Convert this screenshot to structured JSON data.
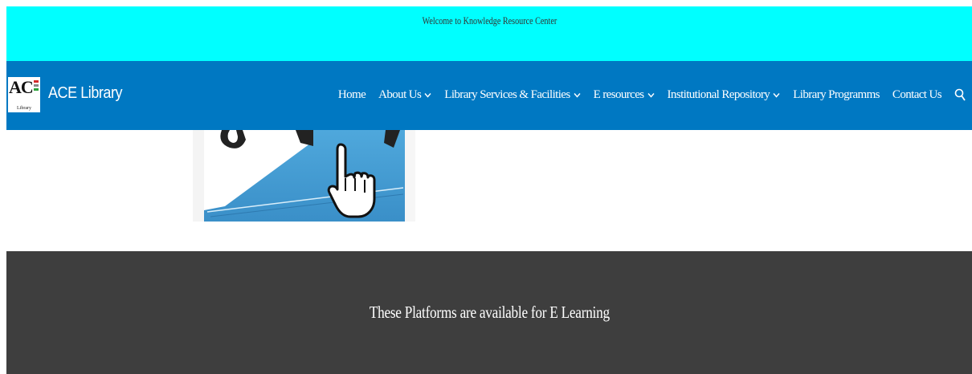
{
  "topbar": {
    "welcome_text": "Welcome to Knowledge Resource Center"
  },
  "header": {
    "logo_text": "AC",
    "logo_subtext": "Library",
    "brand": "ACE Library",
    "menu": [
      {
        "label": "Home",
        "has_dropdown": false
      },
      {
        "label": "About Us",
        "has_dropdown": true
      },
      {
        "label": "Library Services & Facilities",
        "has_dropdown": true
      },
      {
        "label": "E resources",
        "has_dropdown": true
      },
      {
        "label": "Institutional Repository",
        "has_dropdown": true
      },
      {
        "label": "Library Programms",
        "has_dropdown": false
      },
      {
        "label": "Contact Us",
        "has_dropdown": false
      }
    ],
    "search_icon": "search-icon"
  },
  "hero_image": {
    "icon": "hand-cursor-icon"
  },
  "section": {
    "heading": "These Platforms are available for E Learning"
  },
  "colors": {
    "topbar_bg": "#00ffff",
    "navbar_bg": "#0078c2",
    "dark_band_bg": "#3e3e3e"
  }
}
